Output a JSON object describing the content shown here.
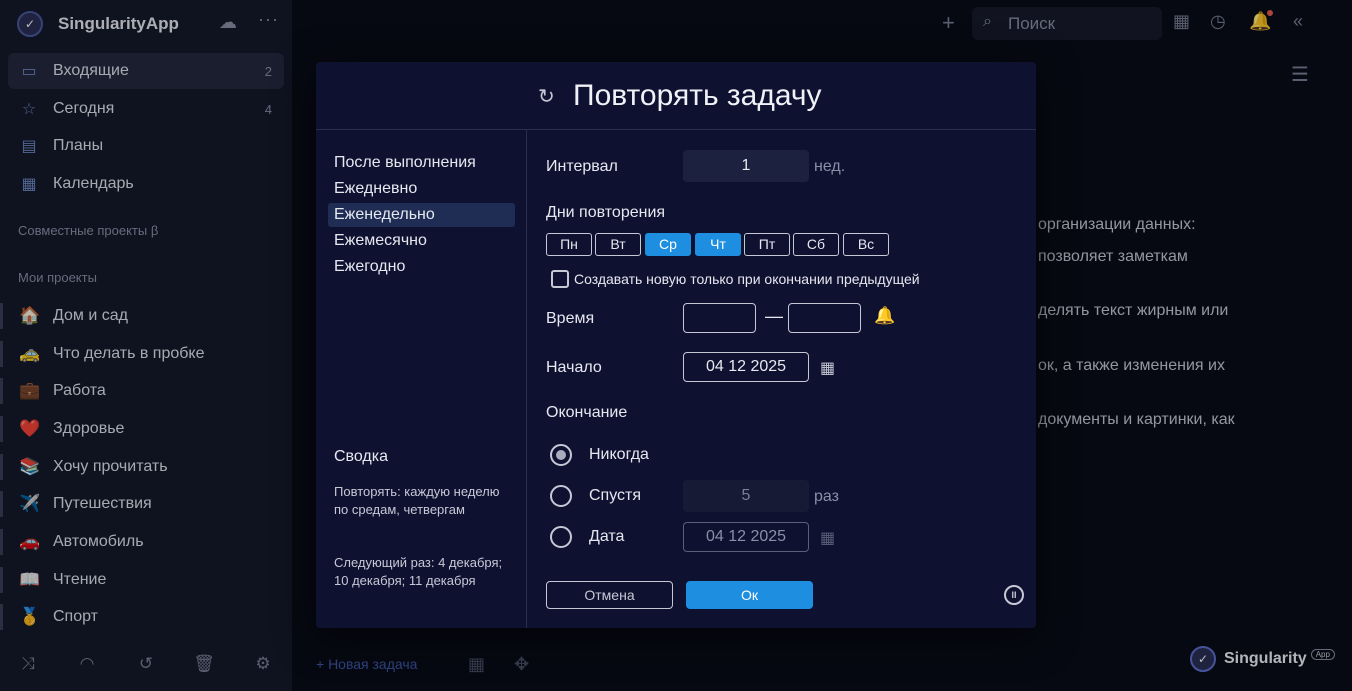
{
  "app": {
    "title": "SingularityApp"
  },
  "sidebar": {
    "nav": [
      {
        "label": "Входящие",
        "count": "2",
        "icon": "inbox-icon"
      },
      {
        "label": "Сегодня",
        "count": "4",
        "icon": "star-icon"
      },
      {
        "label": "Планы",
        "count": "",
        "icon": "plans-icon"
      },
      {
        "label": "Календарь",
        "count": "",
        "icon": "calendar-icon"
      }
    ],
    "shared_projects_title": "Совместные проекты β",
    "my_projects_title": "Мои проекты",
    "projects": [
      {
        "label": "Дом и сад",
        "icon": "🏠"
      },
      {
        "label": "Что делать в пробке",
        "icon": "🚕"
      },
      {
        "label": "Работа",
        "icon": "💼"
      },
      {
        "label": "Здоровье",
        "icon": "❤️"
      },
      {
        "label": "Хочу прочитать",
        "icon": "📚"
      },
      {
        "label": "Путешествия",
        "icon": "✈️"
      },
      {
        "label": "Автомобиль",
        "icon": "🚗"
      },
      {
        "label": "Чтение",
        "icon": "📖"
      },
      {
        "label": "Спорт",
        "icon": "🥇"
      }
    ]
  },
  "topbar": {
    "search_placeholder": "Поиск"
  },
  "background_text": [
    "организации данных:",
    "позволяет заметкам",
    "делять текст жирным или",
    "ок, а также изменения их",
    "документы и картинки, как"
  ],
  "bottom": {
    "new_task": "+ Новая задача"
  },
  "brand": {
    "name": "Singularity",
    "badge": "App"
  },
  "modal": {
    "title": "Повторять задачу",
    "frequencies": [
      "После выполнения",
      "Ежедневно",
      "Еженедельно",
      "Ежемесячно",
      "Ежегодно"
    ],
    "selected_frequency": "Еженедельно",
    "summary": {
      "title": "Сводка",
      "text": "Повторять: каждую неделю по средам, четвергам",
      "next": "Следующий раз: 4 декабря; 10 декабря; 11 декабря"
    },
    "interval": {
      "label": "Интервал",
      "value": "1",
      "unit": "нед."
    },
    "days": {
      "label": "Дни повторения",
      "items": [
        {
          "label": "Пн",
          "on": false
        },
        {
          "label": "Вт",
          "on": false
        },
        {
          "label": "Ср",
          "on": true
        },
        {
          "label": "Чт",
          "on": true
        },
        {
          "label": "Пт",
          "on": false
        },
        {
          "label": "Сб",
          "on": false
        },
        {
          "label": "Вс",
          "on": false
        }
      ]
    },
    "only_after_complete": {
      "label": "Создавать новую только при окончании предыдущей",
      "checked": false
    },
    "time": {
      "label": "Время",
      "from": "",
      "to": "",
      "dash": "—"
    },
    "start": {
      "label": "Начало",
      "value": "04 12 2025"
    },
    "end": {
      "label": "Окончание",
      "never": "Никогда",
      "after": "Спустя",
      "after_value": "5",
      "after_unit": "раз",
      "date": "Дата",
      "date_value": "04 12 2025",
      "selected": "never"
    },
    "cancel_label": "Отмена",
    "ok_label": "Ок"
  },
  "colors": {
    "accent": "#1e8fe0",
    "background": "#0a0c18",
    "sidebar": "#15182a",
    "modal": "#0f1130"
  }
}
